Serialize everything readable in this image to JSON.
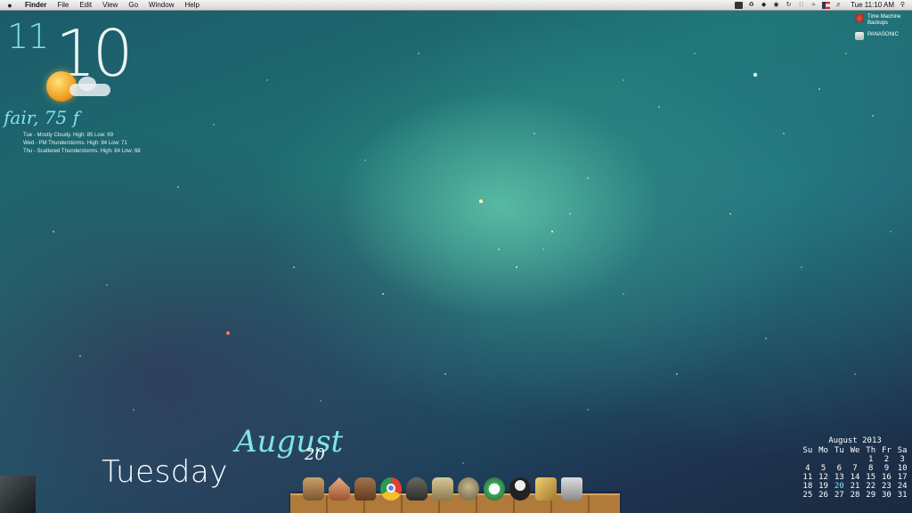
{
  "menubar": {
    "app": "Finder",
    "items": [
      "File",
      "Edit",
      "View",
      "Go",
      "Window",
      "Help"
    ],
    "clock": "Tue 11:10 AM"
  },
  "clock_widget": {
    "hour": "11",
    "minute": "10"
  },
  "weather": {
    "current": "fair, 75 f",
    "forecast": [
      "Tue - Mostly Cloudy. High: 85 Low: 69",
      "Wed - PM Thunderstorms. High: 84 Low: 71",
      "Thu - Scattered Thunderstorms. High: 84 Low: 68"
    ],
    "icon": "sun-cloud-icon"
  },
  "drives": [
    {
      "label": "Time Machine Backups",
      "icon": "time-machine-drive-icon"
    },
    {
      "label": "PANASONIC",
      "icon": "usb-drive-icon"
    }
  ],
  "date_widget": {
    "day": "Tuesday",
    "month": "August",
    "date": "20"
  },
  "calendar": {
    "title": "August 2013",
    "weekdays": [
      "Su",
      "Mo",
      "Tu",
      "We",
      "Th",
      "Fr",
      "Sa"
    ],
    "weeks": [
      [
        "",
        "",
        "",
        "",
        "1",
        "2",
        "3"
      ],
      [
        "4",
        "5",
        "6",
        "7",
        "8",
        "9",
        "10"
      ],
      [
        "11",
        "12",
        "13",
        "14",
        "15",
        "16",
        "17"
      ],
      [
        "18",
        "19",
        "20",
        "21",
        "22",
        "23",
        "24"
      ],
      [
        "25",
        "26",
        "27",
        "28",
        "29",
        "30",
        "31"
      ]
    ],
    "today": "20"
  },
  "dock": [
    "finder-icon",
    "home-icon",
    "box-icon",
    "chrome-icon",
    "music-icon",
    "notes-icon",
    "face-icon",
    "green-app-icon",
    "suit-icon",
    "edit-icon",
    "trash-icon"
  ]
}
